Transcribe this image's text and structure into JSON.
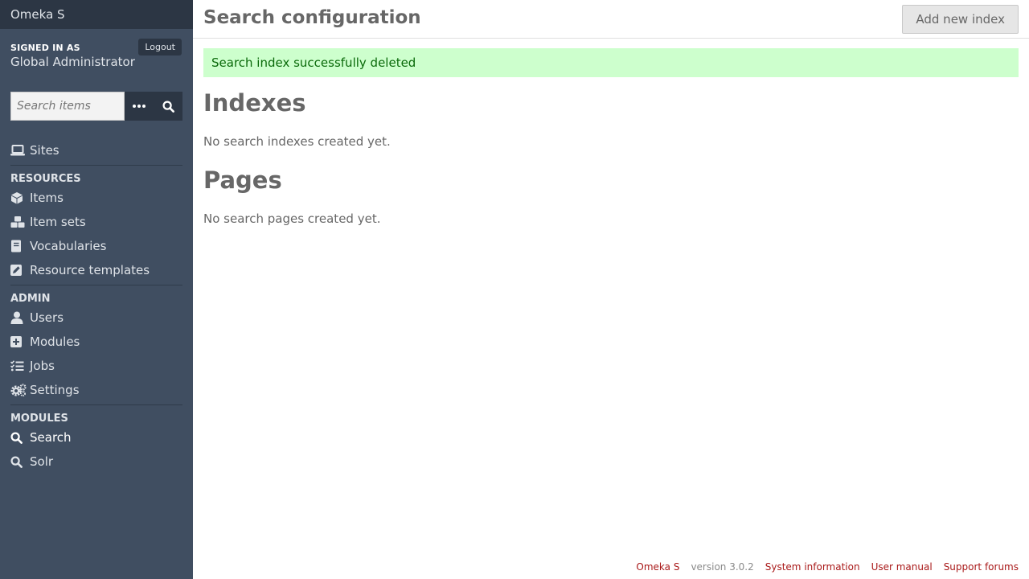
{
  "brand": "Omeka S",
  "user": {
    "signed_in_label": "Signed in as",
    "name": "Global Administrator",
    "logout_label": "Logout"
  },
  "search": {
    "placeholder": "Search items"
  },
  "nav": {
    "sites": "Sites",
    "resources_heading": "Resources",
    "resources": [
      "Items",
      "Item sets",
      "Vocabularies",
      "Resource templates"
    ],
    "admin_heading": "Admin",
    "admin": [
      "Users",
      "Modules",
      "Jobs",
      "Settings"
    ],
    "modules_heading": "Modules",
    "modules": [
      "Search",
      "Solr"
    ]
  },
  "header": {
    "title": "Search configuration",
    "add_button": "Add new index"
  },
  "flash": "Search index successfully deleted",
  "indexes": {
    "heading": "Indexes",
    "empty": "No search indexes created yet."
  },
  "pages": {
    "heading": "Pages",
    "empty": "No search pages created yet."
  },
  "footer": {
    "app_name": "Omeka S",
    "version": "version 3.0.2",
    "system_info": "System information",
    "user_manual": "User manual",
    "support": "Support forums"
  },
  "colors": {
    "sidebar_bg": "#404e61",
    "sidebar_dark": "#2c3644",
    "flash_bg": "#cdffcd",
    "flash_text": "#0a6a0a",
    "link": "#a91919"
  },
  "icons": {
    "sites": "laptop-icon",
    "items": "cube-icon",
    "item_sets": "cubes-icon",
    "vocabularies": "book-icon",
    "resource_templates": "pencil-square-icon",
    "users": "user-icon",
    "modules": "plus-square-icon",
    "jobs": "tasks-icon",
    "settings": "cogs-icon",
    "search": "search-icon",
    "solr": "search-icon"
  }
}
